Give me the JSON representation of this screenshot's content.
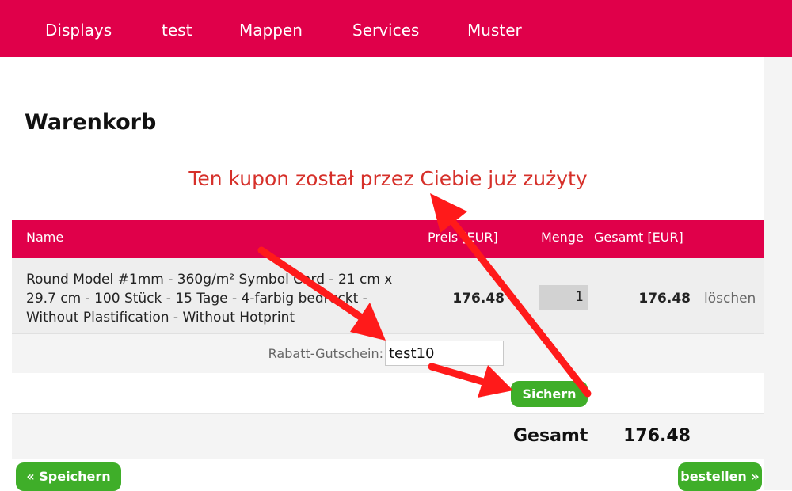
{
  "nav": {
    "items": [
      "Displays",
      "test",
      "Mappen",
      "Services",
      "Muster"
    ]
  },
  "page": {
    "title": "Warenkorb",
    "message": "Ten kupon został przez Ciebie już zużyty"
  },
  "table": {
    "headers": {
      "name": "Name",
      "price": "Preis [EUR]",
      "quantity": "Menge",
      "total": "Gesamt [EUR]"
    },
    "item": {
      "name_lines": [
        "Round Model #1mm - 360g/m² Symbol Card - 21 cm x",
        "29.7 cm - 100 Stück - 15 Tage - 4-farbig bedruckt -",
        "Without Plastification - Without Hotprint"
      ],
      "price": "176.48",
      "quantity": "1",
      "total": "176.48",
      "delete": "löschen"
    },
    "coupon": {
      "label": "Rabatt-Gutschein:",
      "value": "test10"
    },
    "save_button": "Sichern",
    "grand_total_label": "Gesamt",
    "grand_total_value": "176.48"
  },
  "buttons": {
    "back": "« Speichern",
    "order": "bestellen »"
  },
  "colors": {
    "brand": "#e0004a",
    "button_green": "#3fae29",
    "message_red": "#d6302a",
    "annotation_arrow": "#ff1a1a"
  },
  "annotations": {
    "arrows": [
      "arrow-to-coupon-input",
      "arrow-to-save-button",
      "arrow-to-message"
    ]
  }
}
